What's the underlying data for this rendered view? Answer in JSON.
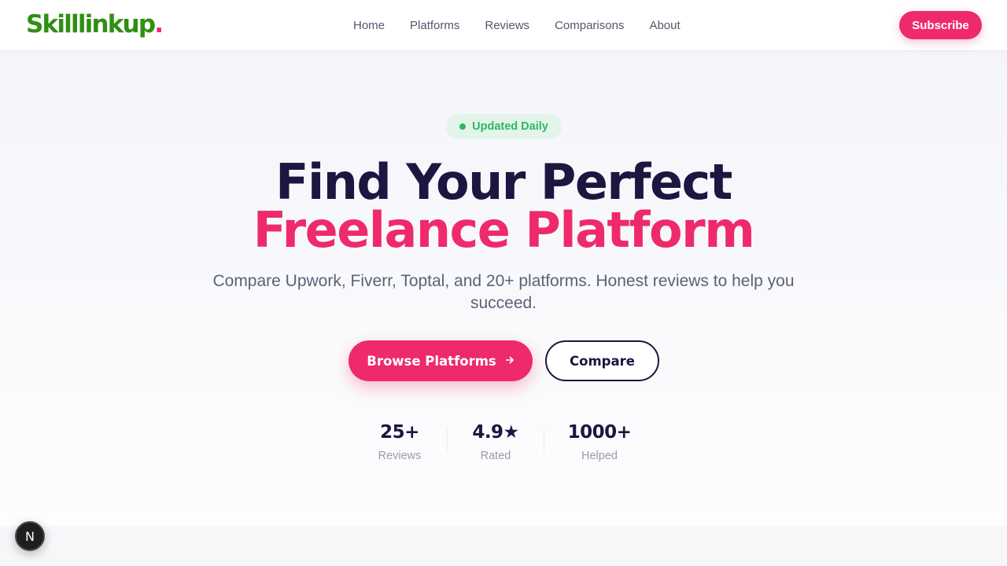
{
  "header": {
    "logo_text": "Skilllinkup",
    "logo_dot": ".",
    "nav": [
      {
        "label": "Home"
      },
      {
        "label": "Platforms"
      },
      {
        "label": "Reviews"
      },
      {
        "label": "Comparisons"
      },
      {
        "label": "About"
      }
    ],
    "subscribe_label": "Subscribe"
  },
  "hero": {
    "badge_label": "Updated Daily",
    "title_line1": "Find Your Perfect",
    "title_line2": "Freelance Platform",
    "subtitle": "Compare Upwork, Fiverr, Toptal, and 20+ platforms. Honest reviews to help you succeed.",
    "primary_button_label": "Browse Platforms",
    "primary_button_icon": "arrow-right-icon",
    "secondary_button_label": "Compare",
    "stats": [
      {
        "value": "25+",
        "label": "Reviews"
      },
      {
        "value": "4.9★",
        "label": "Rated"
      },
      {
        "value": "1000+",
        "label": "Helped"
      }
    ]
  },
  "dev_badge": {
    "label": "N"
  },
  "colors": {
    "brand_green": "#2f8f12",
    "accent_pink": "#ee2a6b",
    "navy": "#1c1640",
    "badge_green": "#2cba5f"
  }
}
